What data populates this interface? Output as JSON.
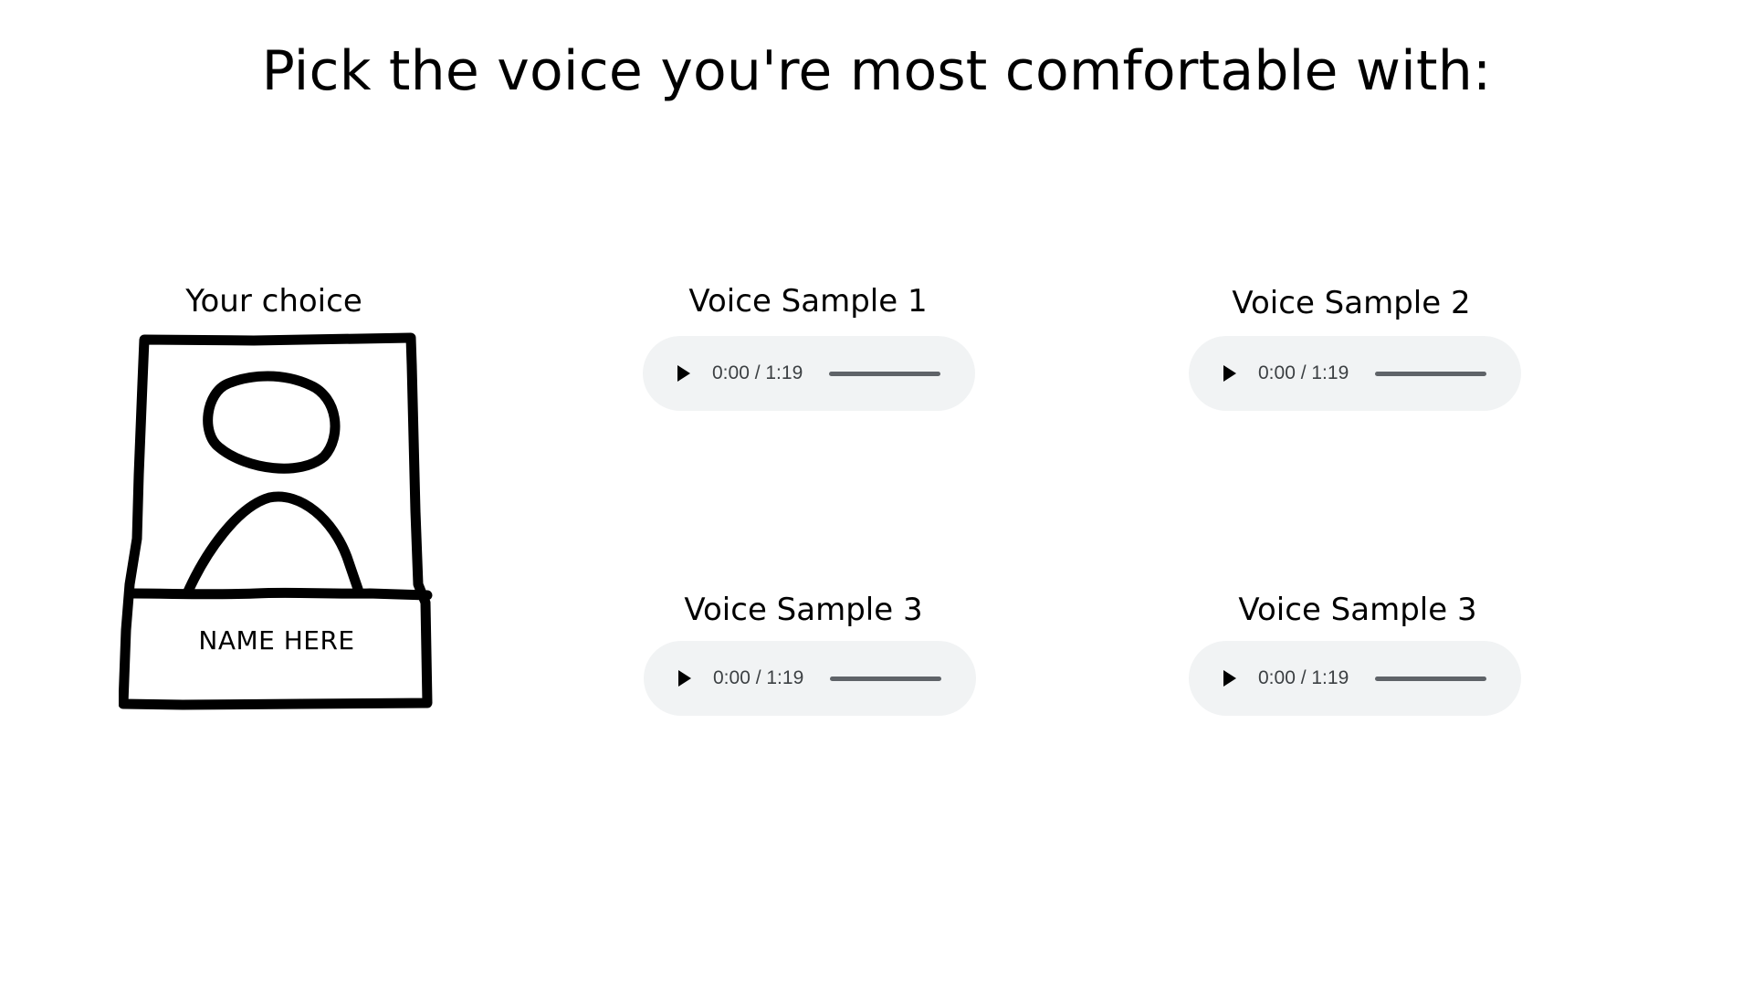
{
  "slide": {
    "title": "Pick the voice you're most comfortable with:"
  },
  "choice": {
    "label": "Your choice",
    "name_placeholder": "NAME HERE"
  },
  "samples": [
    {
      "label": "Voice Sample 1",
      "time": "0:00 / 1:19",
      "progress": 0
    },
    {
      "label": "Voice Sample 2",
      "time": "0:00 / 1:19",
      "progress": 0
    },
    {
      "label": "Voice Sample 3",
      "time": "0:00 / 1:19",
      "progress": 0
    },
    {
      "label": "Voice Sample 3",
      "time": "0:00 / 1:19",
      "progress": 0
    }
  ],
  "icons": {
    "play": "play-icon",
    "avatar": "person-silhouette-icon"
  },
  "colors": {
    "player_bg": "#f1f3f4",
    "player_text": "#3c4043",
    "progress_track": "#5f6368"
  }
}
